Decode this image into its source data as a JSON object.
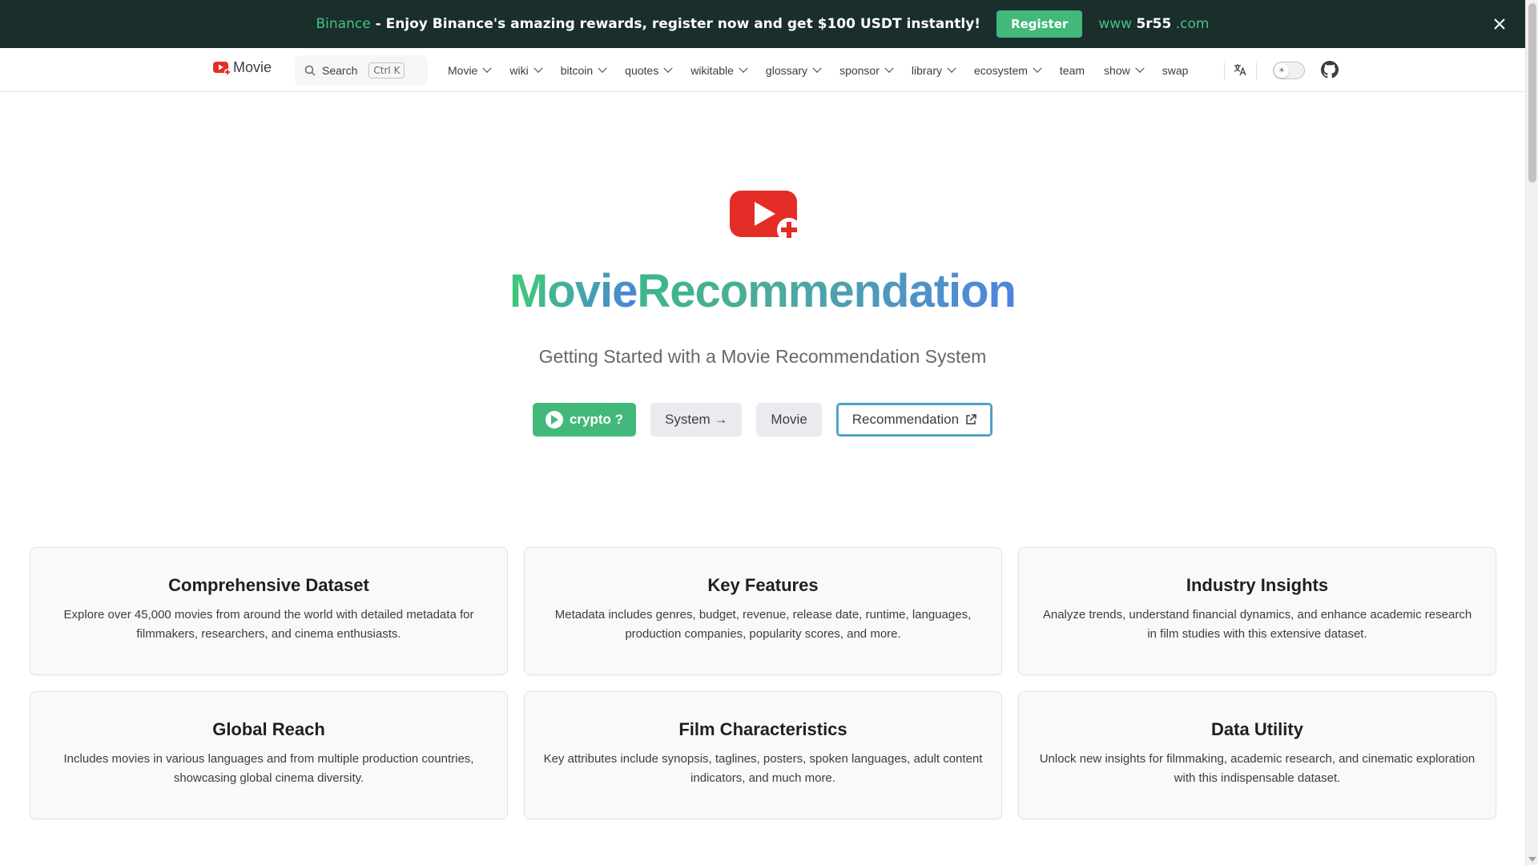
{
  "banner": {
    "brand": "Binance",
    "message": " - Enjoy Binance's amazing rewards, register now and get $100 USDT instantly!",
    "register_label": "Register",
    "site_prefix": "www ",
    "site_main": "5r55",
    "site_suffix": " .com"
  },
  "nav": {
    "logo_text": "Movie",
    "search_label": "Search",
    "search_kbd": "Ctrl K",
    "items": [
      {
        "label": "Movie",
        "dropdown": true
      },
      {
        "label": "wiki",
        "dropdown": true
      },
      {
        "label": "bitcoin",
        "dropdown": true
      },
      {
        "label": "quotes",
        "dropdown": true
      },
      {
        "label": "wikitable",
        "dropdown": true
      },
      {
        "label": "glossary",
        "dropdown": true
      },
      {
        "label": "sponsor",
        "dropdown": true
      },
      {
        "label": "library",
        "dropdown": true
      },
      {
        "label": "ecosystem",
        "dropdown": true
      },
      {
        "label": "team",
        "dropdown": false
      },
      {
        "label": "show",
        "dropdown": true
      },
      {
        "label": "swap",
        "dropdown": false
      }
    ],
    "translate_icon": "translate-icon",
    "theme_icon": "sun-icon",
    "github_icon": "github-icon"
  },
  "hero": {
    "title_part1": "Movie",
    "title_part2": "Recommendation",
    "subtitle": "Getting Started with a Movie Recommendation System",
    "actions": {
      "brand": "crypto ?",
      "system": "System →",
      "movie": "Movie",
      "recommendation": "Recommendation"
    }
  },
  "features": [
    {
      "title": "Comprehensive Dataset",
      "details": "Explore over 45,000 movies from around the world with detailed metadata for filmmakers, researchers, and cinema enthusiasts."
    },
    {
      "title": "Key Features",
      "details": "Metadata includes genres, budget, revenue, release date, runtime, languages, production companies, popularity scores, and more."
    },
    {
      "title": "Industry Insights",
      "details": "Analyze trends, understand financial dynamics, and enhance academic research in film studies with this extensive dataset."
    },
    {
      "title": "Global Reach",
      "details": "Includes movies in various languages and from multiple production countries, showcasing global cinema diversity."
    },
    {
      "title": "Film Characteristics",
      "details": "Key attributes include synopsis, taglines, posters, spoken languages, adult content indicators, and much more."
    },
    {
      "title": "Data Utility",
      "details": "Unlock new insights for filmmaking, academic research, and cinematic exploration with this indispensable dataset."
    }
  ],
  "colors": {
    "brand": "#42b97a",
    "banner_bg": "#1a2e2c",
    "logo_red": "#e52d27"
  }
}
